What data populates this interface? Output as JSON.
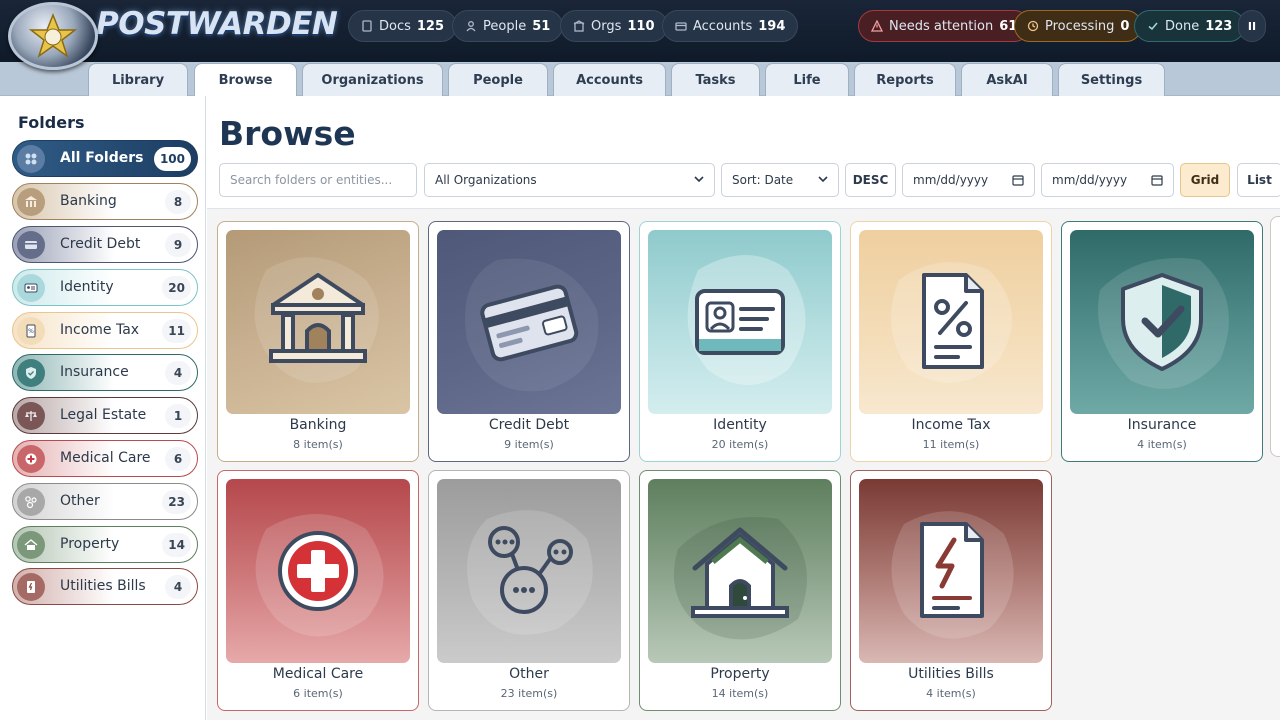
{
  "app": {
    "name": "POSTWARDEN"
  },
  "header_stats": [
    {
      "label": "Docs",
      "value": "125",
      "icon": "doc-icon"
    },
    {
      "label": "People",
      "value": "51",
      "icon": "person-icon"
    },
    {
      "label": "Orgs",
      "value": "110",
      "icon": "building-icon"
    },
    {
      "label": "Accounts",
      "value": "194",
      "icon": "card-icon"
    }
  ],
  "status_pills": [
    {
      "label": "Needs attention",
      "value": "61",
      "icon": "warning-icon",
      "color": "#c0393f"
    },
    {
      "label": "Processing",
      "value": "0",
      "icon": "clock-icon",
      "color": "#c9892c"
    },
    {
      "label": "Done",
      "value": "123",
      "icon": "check-icon",
      "color": "#3c8f91"
    }
  ],
  "pause_label": "II",
  "tabs": [
    "Library",
    "Browse",
    "Organizations",
    "People",
    "Accounts",
    "Tasks",
    "Life",
    "Reports",
    "AskAI",
    "Settings"
  ],
  "active_tab": "Browse",
  "sidebar": {
    "title": "Folders",
    "items": [
      {
        "label": "All Folders",
        "count": "100",
        "active": true,
        "color": "#1d3d62"
      },
      {
        "label": "Banking",
        "count": "8",
        "color": "#a0825c"
      },
      {
        "label": "Credit Debt",
        "count": "9",
        "color": "#4e5672"
      },
      {
        "label": "Identity",
        "count": "20",
        "color": "#7cc3c8"
      },
      {
        "label": "Income Tax",
        "count": "11",
        "color": "#ecc48f"
      },
      {
        "label": "Insurance",
        "count": "4",
        "color": "#2f6a6a"
      },
      {
        "label": "Legal Estate",
        "count": "1",
        "color": "#5a3a3a"
      },
      {
        "label": "Medical Care",
        "count": "6",
        "color": "#b94a4e"
      },
      {
        "label": "Other",
        "count": "23",
        "color": "#8c8c8c"
      },
      {
        "label": "Property",
        "count": "14",
        "color": "#5e7f5e"
      },
      {
        "label": "Utilities Bills",
        "count": "4",
        "color": "#8a4a44"
      }
    ]
  },
  "main": {
    "title": "Browse",
    "search_placeholder": "Search folders or entities...",
    "org_filter": "All Organizations",
    "sort": "Sort: Date",
    "order_button": "DESC",
    "date_from": "mm/dd/yyyy",
    "date_to": "mm/dd/yyyy",
    "grid_button": "Grid",
    "list_button": "List"
  },
  "cards": [
    {
      "name": "Banking",
      "count": "8 item(s)",
      "icon": "bank-icon",
      "color": "#a0825c"
    },
    {
      "name": "Credit Debt",
      "count": "9 item(s)",
      "icon": "credit-card-icon",
      "color": "#4e5672"
    },
    {
      "name": "Identity",
      "count": "20 item(s)",
      "icon": "id-card-icon",
      "color": "#7cc3c8"
    },
    {
      "name": "Income Tax",
      "count": "11 item(s)",
      "icon": "tax-document-icon",
      "color": "#ecc48f"
    },
    {
      "name": "Insurance",
      "count": "4 item(s)",
      "icon": "shield-check-icon",
      "color": "#2f6a6a"
    },
    {
      "name": "Medical Care",
      "count": "6 item(s)",
      "icon": "medical-cross-icon",
      "color": "#b94a4e"
    },
    {
      "name": "Other",
      "count": "23 item(s)",
      "icon": "molecule-icon",
      "color": "#8c8c8c"
    },
    {
      "name": "Property",
      "count": "14 item(s)",
      "icon": "house-icon",
      "color": "#5e7f5e"
    },
    {
      "name": "Utilities Bills",
      "count": "4 item(s)",
      "icon": "electric-bill-icon",
      "color": "#8a4a44"
    }
  ]
}
